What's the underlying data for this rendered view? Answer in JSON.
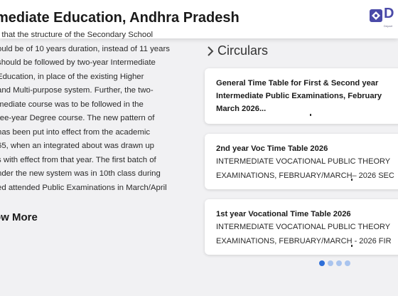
{
  "header": {
    "title": "mediate Education, Andhra Pradesh",
    "logo_letter": "D",
    "logo_sub": "Depart"
  },
  "about": {
    "lines": [
      "t that the structure of the Secondary School",
      "ould be of 10 years duration, instead of 11 years",
      "should be followed by two-year Intermediate",
      "Education, in place of the existing Higher",
      "and Multi-purpose system. Further, the two-",
      "mediate course was to be followed in the",
      "ree-year Degree course. The new pattern of",
      "has been put into effect from the academic",
      "65, when an integrated about was drawn up",
      "s with effect from that year. The first batch of",
      "nder the new system was in 10th class during",
      "ed attended Public Examinations in March/April"
    ],
    "know_more": "ow More"
  },
  "circulars": {
    "heading": "Circulars",
    "cards": [
      {
        "title_lines": [
          "General Time Table for First & Second year",
          "Intermediate Public Examinations, February",
          "March 2026..."
        ],
        "body_lines": []
      },
      {
        "title_lines": [
          "2nd year Voc Time Table 2026"
        ],
        "body_lines": [
          "INTERMEDIATE VOCATIONAL PUBLIC THEORY",
          "EXAMINATIONS, FEBRUARY/MARCH– 2026 SEC"
        ]
      },
      {
        "title_lines": [
          "1st year Vocational Time Table 2026"
        ],
        "body_lines": [
          "INTERMEDIATE VOCATIONAL PUBLIC THEORY",
          "EXAMINATIONS, FEBRUARY/MARCH - 2026 FIR"
        ]
      }
    ],
    "pagination": {
      "total": 4,
      "active": 1
    }
  },
  "colors": {
    "accent": "#2e6fd8",
    "dot_inactive": "#a9c4ee",
    "logo": "#4a4aa8"
  }
}
